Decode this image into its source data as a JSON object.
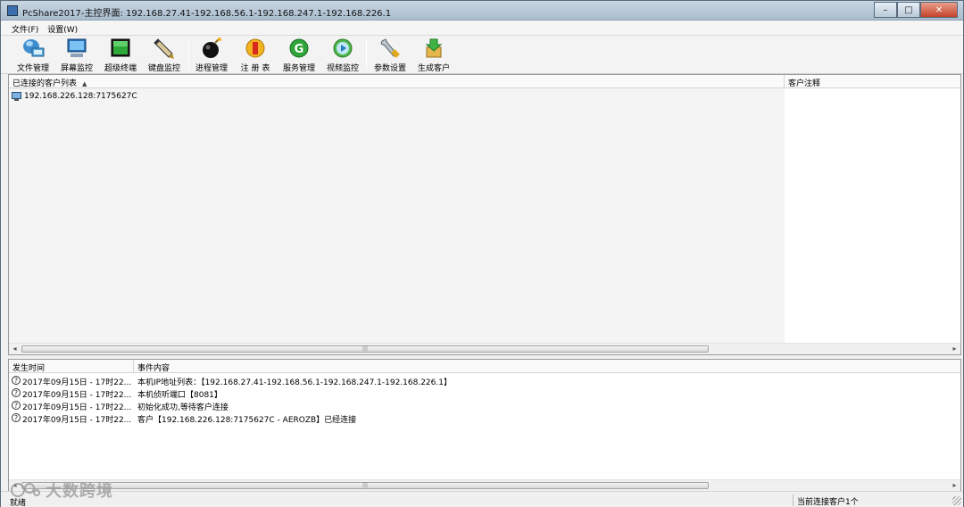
{
  "window": {
    "title": "PcShare2017-主控界面: 192.168.27.41-192.168.56.1-192.168.247.1-192.168.226.1",
    "buttons": {
      "minimize": "–",
      "maximize": "□",
      "close": "✕"
    }
  },
  "menu": [
    {
      "label": "文件(F)"
    },
    {
      "label": "设置(W)"
    }
  ],
  "toolbar": [
    {
      "label": "文件管理",
      "icon": "file-manager-icon"
    },
    {
      "label": "屏幕监控",
      "icon": "screen-monitor-icon"
    },
    {
      "label": "超级终端",
      "icon": "terminal-icon"
    },
    {
      "label": "键盘监控",
      "icon": "keyboard-monitor-icon"
    },
    {
      "label": "进程管理",
      "icon": "process-bomb-icon"
    },
    {
      "label": "注 册 表",
      "icon": "registry-icon"
    },
    {
      "label": "服务管理",
      "icon": "service-icon"
    },
    {
      "label": "视频监控",
      "icon": "video-play-icon"
    },
    {
      "label": "参数设置",
      "icon": "wrench-icon"
    },
    {
      "label": "生成客户",
      "icon": "build-client-icon"
    }
  ],
  "client_list": {
    "col_clients": "已连接的客户列表",
    "col_notes": "客户注释",
    "rows": [
      {
        "name": "192.168.226.128:7175627C"
      }
    ]
  },
  "event_log": {
    "col_time": "发生时间",
    "col_event": "事件内容",
    "rows": [
      {
        "time": "2017年09月15日 - 17时22...",
        "event": "本机IP地址列表：【192.168.27.41-192.168.56.1-192.168.247.1-192.168.226.1】"
      },
      {
        "time": "2017年09月15日 - 17时22...",
        "event": "本机侦听端口【8081】"
      },
      {
        "time": "2017年09月15日 - 17时22...",
        "event": "初始化成功,等待客户连接"
      },
      {
        "time": "2017年09月15日 - 17时22...",
        "event": "客户【192.168.226.128:7175627C - AEROZB】已经连接"
      }
    ]
  },
  "scroll_grip": "|||",
  "status": {
    "left": "就绪",
    "right": "当前连接客户1个"
  },
  "watermark": "大数跨境",
  "colors": {
    "titlebar": "#b4c5d6",
    "close_button": "#c4412a",
    "pane_bg": "#f4f4f4"
  }
}
